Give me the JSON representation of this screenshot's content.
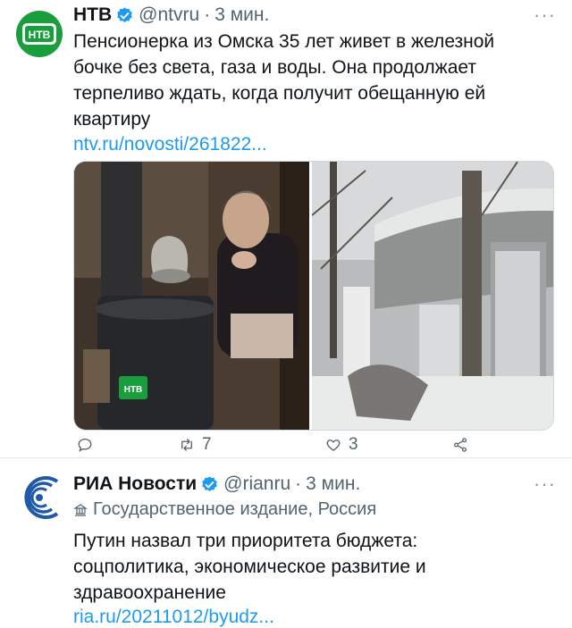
{
  "tweets": [
    {
      "author": "НТВ",
      "handle": "@ntvru",
      "separator": "·",
      "time": "3 мин.",
      "avatar_text": "НТВ",
      "more": "···",
      "text_lines": [
        "Пенсионерка из Омска 35 лет живет в железной",
        "бочке без света, газа и воды. Она продолжает",
        "терпеливо ждать, когда получит обещанную ей",
        "квартиру"
      ],
      "link": "ntv.ru/novosti/261822...",
      "media_logo": "НТВ",
      "actions": {
        "reply": "",
        "retweet": "7",
        "like": "3"
      }
    },
    {
      "author": "РИА Новости",
      "handle": "@rianru",
      "separator": "·",
      "time": "3 мин.",
      "more": "···",
      "label": "Государственное издание, Россия",
      "text_lines": [
        "Путин назвал три приоритета бюджета:",
        "соцполитика, экономическое развитие и",
        "здравоохранение"
      ],
      "link": "ria.ru/20211012/byudz..."
    }
  ],
  "colors": {
    "link": "#1d9bf0",
    "verified": "#1d9bf0",
    "ntv_green": "#1a9e3d",
    "ria_blue": "#1e5aa8",
    "muted": "#536471"
  },
  "icons": [
    "verified-badge-icon",
    "reply-icon",
    "retweet-icon",
    "like-icon",
    "share-icon",
    "state-media-icon"
  ]
}
